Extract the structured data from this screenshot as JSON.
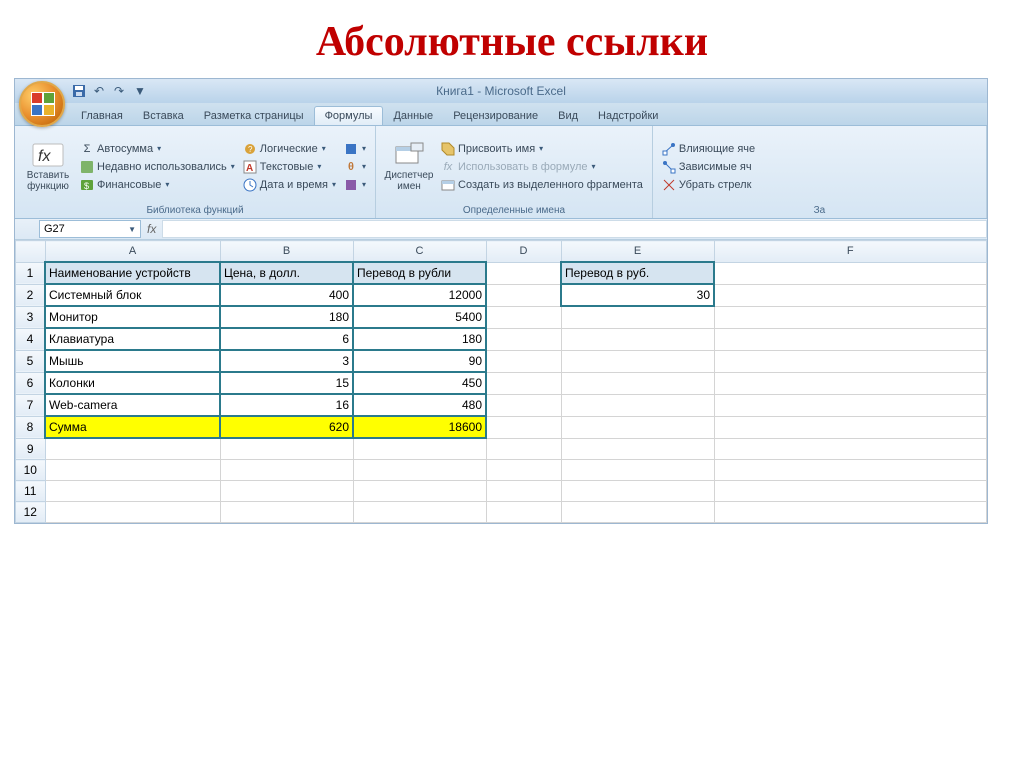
{
  "slide_title": "Абсолютные ссылки",
  "window_title": "Книга1 - Microsoft Excel",
  "tabs": {
    "home": "Главная",
    "insert": "Вставка",
    "layout": "Разметка страницы",
    "formulas": "Формулы",
    "data": "Данные",
    "review": "Рецензирование",
    "view": "Вид",
    "addins": "Надстройки"
  },
  "ribbon": {
    "insert_fn": "Вставить функцию",
    "autosum": "Автосумма",
    "recent": "Недавно использовались",
    "financial": "Финансовые",
    "logical": "Логические",
    "text": "Текстовые",
    "datetime": "Дата и время",
    "more_fn_a": "",
    "more_fn_b": "",
    "more_fn_c": "",
    "group_lib": "Библиотека функций",
    "name_mgr": "Диспетчер имен",
    "assign_name": "Присвоить имя",
    "use_in_formula": "Использовать в формуле",
    "create_sel": "Создать из выделенного фрагмента",
    "group_names": "Определенные имена",
    "trace_prec": "Влияющие яче",
    "trace_dep": "Зависимые яч",
    "remove_arrows": "Убрать стрелк",
    "group_audit": "За"
  },
  "namebox": "G27",
  "cols": {
    "A": "A",
    "B": "B",
    "C": "C",
    "D": "D",
    "E": "E",
    "F": "F"
  },
  "grid": {
    "h1a": "Наименование устройств",
    "h1b": "Цена, в долл.",
    "h1c": "Перевод в рубли",
    "h1e": "Перевод в руб.",
    "r2a": "Системный блок",
    "r2b": "400",
    "r2c": "12000",
    "r2e": "30",
    "r3a": "Монитор",
    "r3b": "180",
    "r3c": "5400",
    "r4a": "Клавиатура",
    "r4b": "6",
    "r4c": "180",
    "r5a": "Мышь",
    "r5b": "3",
    "r5c": "90",
    "r6a": "Колонки",
    "r6b": "15",
    "r6c": "450",
    "r7a": "Web-camera",
    "r7b": "16",
    "r7c": "480",
    "r8a": "Сумма",
    "r8b": "620",
    "r8c": "18600"
  },
  "chart_data": {
    "type": "table",
    "title": "Абсолютные ссылки",
    "columns": [
      "Наименование устройств",
      "Цена, в долл.",
      "Перевод в рубли"
    ],
    "rows": [
      [
        "Системный блок",
        400,
        12000
      ],
      [
        "Монитор",
        180,
        5400
      ],
      [
        "Клавиатура",
        6,
        180
      ],
      [
        "Мышь",
        3,
        90
      ],
      [
        "Колонки",
        15,
        450
      ],
      [
        "Web-camera",
        16,
        480
      ],
      [
        "Сумма",
        620,
        18600
      ]
    ],
    "aux": {
      "Перевод в руб.": 30
    }
  }
}
